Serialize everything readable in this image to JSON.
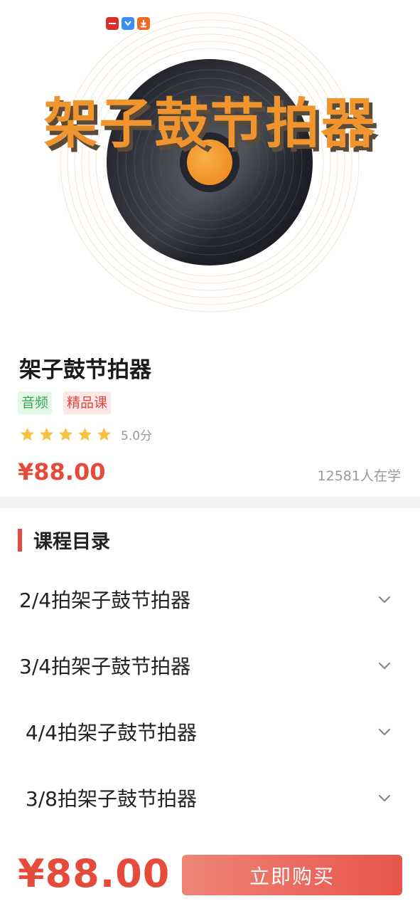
{
  "cover": {
    "title": "架子鼓节拍器",
    "status_icons": [
      "red-app-icon",
      "blue-app-icon",
      "download-icon"
    ]
  },
  "course": {
    "title": "架子鼓节拍器",
    "tags": [
      "音频",
      "精品课"
    ],
    "rating_stars": 5,
    "rating_text": "5.0分",
    "price": "¥88.00",
    "learners": "12581人在学"
  },
  "catalog": {
    "heading": "课程目录",
    "lessons": [
      {
        "label": "2/4拍架子鼓节拍器"
      },
      {
        "label": "3/4拍架子鼓节拍器"
      },
      {
        "label": " 4/4拍架子鼓节拍器"
      },
      {
        "label": " 3/8拍架子鼓节拍器"
      }
    ]
  },
  "bottom_bar": {
    "price": "¥88.00",
    "buy_label": "立即购买"
  },
  "colors": {
    "accent_red": "#e64a3b",
    "cover_orange": "#f0952e",
    "tag_green": "#3aa657",
    "star_yellow": "#f5c242"
  }
}
